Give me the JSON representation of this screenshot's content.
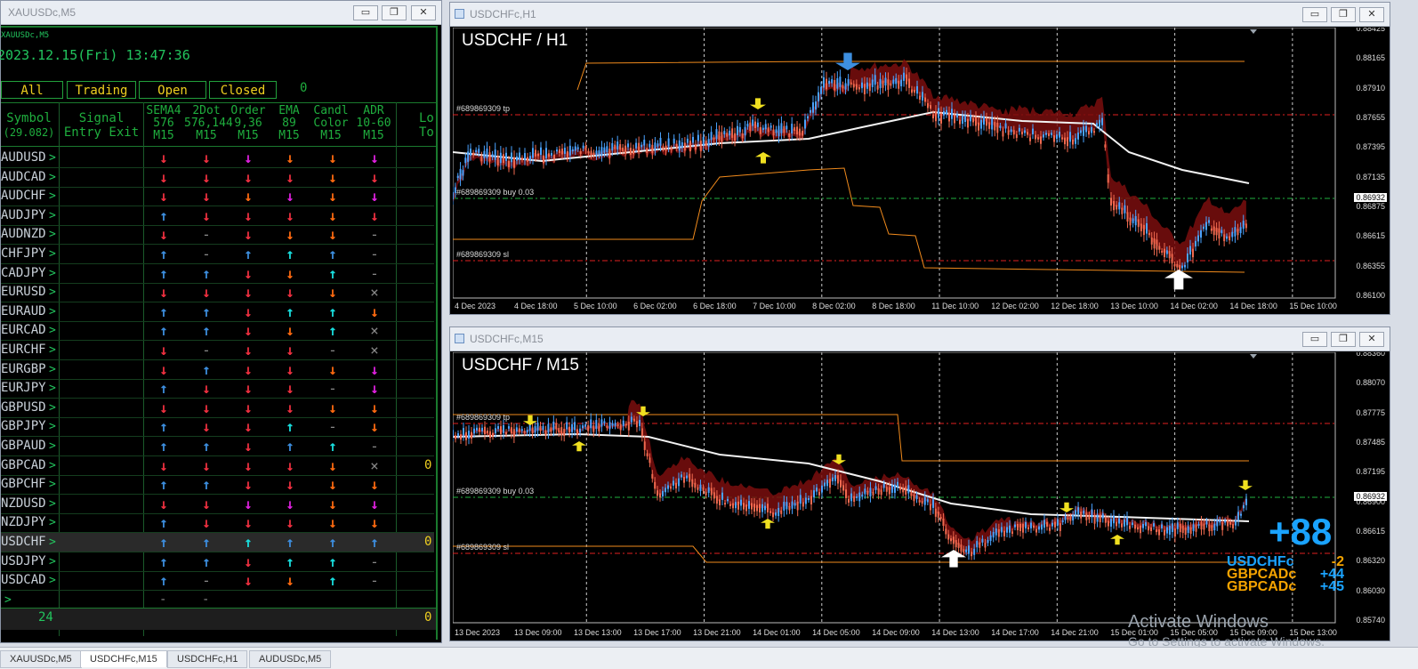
{
  "dash_window": {
    "title": "XAUUSDc,M5",
    "symbol_small": "XAUUSDc,M5",
    "datetime": "2023.12.15(Fri) 13:47:36",
    "tabs": [
      "All",
      "Trading",
      "Open",
      "Closed"
    ],
    "tabs_count": "0",
    "headers": {
      "symbol": [
        "Symbol",
        "(29.082)"
      ],
      "signal": [
        "Signal",
        "Entry Exit"
      ],
      "sema": [
        "SEMA4",
        "576",
        "M15"
      ],
      "dot": [
        "2Dot",
        "576,144",
        "M15"
      ],
      "order": [
        "Order",
        "9,36",
        "M15"
      ],
      "ema": [
        "EMA",
        "89",
        "M15"
      ],
      "candl": [
        "Candl",
        "Color",
        "M15"
      ],
      "adr": [
        "ADR",
        "10-60",
        "M15"
      ],
      "lot": [
        "Lo",
        "To"
      ]
    },
    "rows": [
      {
        "sym": "AUDUSD",
        "arrows": [
          "down-red",
          "down-red",
          "down-magenta",
          "down-orange",
          "down-orange",
          "down-magenta"
        ],
        "val": ""
      },
      {
        "sym": "AUDCAD",
        "arrows": [
          "down-red",
          "down-red",
          "down-red",
          "down-red",
          "down-orange",
          "down-red"
        ],
        "val": ""
      },
      {
        "sym": "AUDCHF",
        "arrows": [
          "down-red",
          "down-red",
          "down-orange",
          "down-magenta",
          "down-orange",
          "down-magenta"
        ],
        "val": ""
      },
      {
        "sym": "AUDJPY",
        "arrows": [
          "up-blue",
          "down-red",
          "down-red",
          "down-red",
          "down-orange",
          "down-red"
        ],
        "val": ""
      },
      {
        "sym": "AUDNZD",
        "arrows": [
          "down-red",
          "dash",
          "down-red",
          "down-orange",
          "down-orange",
          "dash"
        ],
        "val": ""
      },
      {
        "sym": "CHFJPY",
        "arrows": [
          "up-blue",
          "dash",
          "up-blue",
          "up-cyan",
          "up-blue",
          "dash"
        ],
        "val": ""
      },
      {
        "sym": "CADJPY",
        "arrows": [
          "up-blue",
          "up-blue",
          "down-red",
          "down-orange",
          "up-cyan",
          "dash"
        ],
        "val": ""
      },
      {
        "sym": "EURUSD",
        "arrows": [
          "down-red",
          "down-red",
          "down-red",
          "down-red",
          "down-orange",
          "cross"
        ],
        "val": ""
      },
      {
        "sym": "EURAUD",
        "arrows": [
          "up-blue",
          "up-blue",
          "down-red",
          "up-cyan",
          "up-cyan",
          "down-orange"
        ],
        "val": ""
      },
      {
        "sym": "EURCAD",
        "arrows": [
          "up-blue",
          "up-blue",
          "down-red",
          "down-orange",
          "up-cyan",
          "cross"
        ],
        "val": ""
      },
      {
        "sym": "EURCHF",
        "arrows": [
          "down-red",
          "dash",
          "down-red",
          "down-red",
          "dash",
          "cross"
        ],
        "val": ""
      },
      {
        "sym": "EURGBP",
        "arrows": [
          "down-red",
          "up-blue",
          "down-red",
          "down-red",
          "down-orange",
          "down-magenta"
        ],
        "val": ""
      },
      {
        "sym": "EURJPY",
        "arrows": [
          "up-blue",
          "down-red",
          "down-red",
          "down-red",
          "dash",
          "down-magenta"
        ],
        "val": ""
      },
      {
        "sym": "GBPUSD",
        "arrows": [
          "down-red",
          "down-red",
          "down-red",
          "down-red",
          "down-orange",
          "down-orange"
        ],
        "val": ""
      },
      {
        "sym": "GBPJPY",
        "arrows": [
          "up-blue",
          "down-red",
          "down-red",
          "up-cyan",
          "dash",
          "down-orange"
        ],
        "val": ""
      },
      {
        "sym": "GBPAUD",
        "arrows": [
          "up-blue",
          "up-blue",
          "down-red",
          "up-blue",
          "up-cyan",
          "dash"
        ],
        "val": ""
      },
      {
        "sym": "GBPCAD",
        "arrows": [
          "down-red",
          "down-red",
          "down-red",
          "down-red",
          "down-orange",
          "cross"
        ],
        "val": "0"
      },
      {
        "sym": "GBPCHF",
        "arrows": [
          "up-blue",
          "up-blue",
          "down-red",
          "down-red",
          "down-orange",
          "down-orange"
        ],
        "val": ""
      },
      {
        "sym": "NZDUSD",
        "arrows": [
          "down-red",
          "down-red",
          "down-magenta",
          "down-magenta",
          "down-orange",
          "down-magenta"
        ],
        "val": ""
      },
      {
        "sym": "NZDJPY",
        "arrows": [
          "up-blue",
          "down-red",
          "down-red",
          "down-red",
          "down-orange",
          "down-orange"
        ],
        "val": ""
      },
      {
        "sym": "USDCHF",
        "arrows": [
          "up-blue",
          "up-blue",
          "up-cyan",
          "up-blue",
          "up-blue",
          "up-blue"
        ],
        "val": "0",
        "selected": true
      },
      {
        "sym": "USDJPY",
        "arrows": [
          "up-blue",
          "up-blue",
          "down-red",
          "up-cyan",
          "up-cyan",
          "dash"
        ],
        "val": ""
      },
      {
        "sym": "USDCAD",
        "arrows": [
          "up-blue",
          "dash",
          "down-red",
          "down-orange",
          "up-cyan",
          "dash"
        ],
        "val": ""
      }
    ],
    "footer_count": "24",
    "footer_val": "0"
  },
  "chart_h1": {
    "window_title": "USDCHFc,H1",
    "label": "USDCHF / H1",
    "tp_label": "#689869309 tp",
    "buy_label": "#689869309 buy 0.03",
    "sl_label": "#689869309 sl",
    "price_axis": [
      "0.88425",
      "0.88165",
      "0.87910",
      "0.87655",
      "0.87395",
      "0.87135",
      "0.86875",
      "0.86615",
      "0.86355",
      "0.86100"
    ],
    "current_price": "0.86932",
    "time_axis": [
      "4 Dec 2023",
      "4 Dec 18:00",
      "5 Dec 10:00",
      "6 Dec 02:00",
      "6 Dec 18:00",
      "7 Dec 10:00",
      "8 Dec 02:00",
      "8 Dec 18:00",
      "11 Dec 10:00",
      "12 Dec 02:00",
      "12 Dec 18:00",
      "13 Dec 10:00",
      "14 Dec 02:00",
      "14 Dec 18:00",
      "15 Dec 10:00"
    ]
  },
  "chart_m15": {
    "window_title": "USDCHFc,M15",
    "label": "USDCHF / M15",
    "tp_label": "#689869309 tp",
    "buy_label": "#689869309 buy 0.03",
    "sl_label": "#689869309 sl",
    "price_axis": [
      "0.88360",
      "0.88070",
      "0.87775",
      "0.87485",
      "0.87195",
      "0.86900",
      "0.86615",
      "0.86320",
      "0.86030",
      "0.85740"
    ],
    "current_price": "0.86932",
    "time_axis": [
      "13 Dec 2023",
      "13 Dec 09:00",
      "13 Dec 13:00",
      "13 Dec 17:00",
      "13 Dec 21:00",
      "14 Dec 01:00",
      "14 Dec 05:00",
      "14 Dec 09:00",
      "14 Dec 13:00",
      "14 Dec 17:00",
      "14 Dec 21:00",
      "15 Dec 01:00",
      "15 Dec 05:00",
      "15 Dec 09:00",
      "15 Dec 13:00"
    ],
    "score": "+88",
    "pairs": [
      {
        "name": "USDCHFc",
        "value": "-2",
        "color": "#1aa3ff",
        "vcolor": "#f5a300"
      },
      {
        "name": "GBPCADc",
        "value": "+44",
        "color": "#f5a300",
        "vcolor": "#1aa3ff"
      },
      {
        "name": "GBPCADc",
        "value": "+45",
        "color": "#f5a300",
        "vcolor": "#1aa3ff"
      }
    ]
  },
  "bottom_tabs": [
    "XAUUSDc,M5",
    "USDCHFc,M15",
    "USDCHFc,H1",
    "AUDUSDc,M5"
  ],
  "active_tab": 1,
  "watermark": {
    "line1": "Activate Windows",
    "line2": "Go to Settings to activate Windows."
  },
  "colors": {
    "up-blue": "#3d8fe0",
    "up-cyan": "#19e0e0",
    "down-red": "#f03040",
    "down-orange": "#ff6a10",
    "down-magenta": "#e020e0",
    "accent-green": "#22c55e",
    "label-yellow": "#f0d020"
  }
}
